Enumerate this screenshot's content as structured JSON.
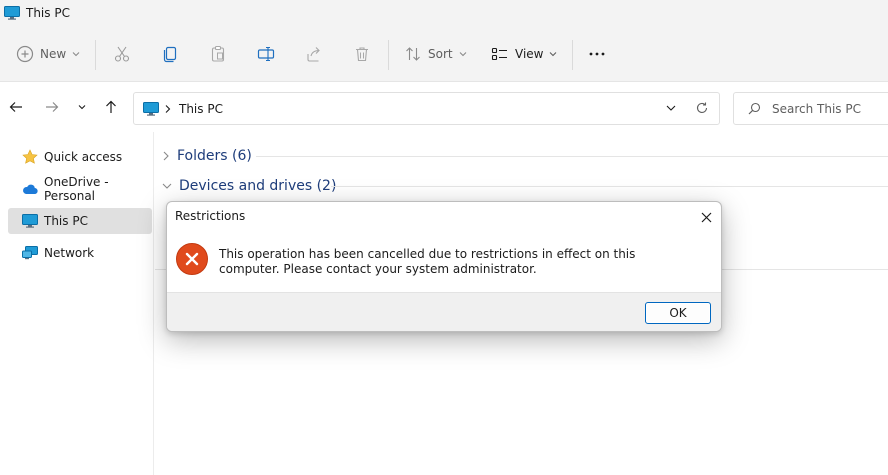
{
  "window": {
    "title": "This PC"
  },
  "toolbar": {
    "new_label": "New",
    "sort_label": "Sort",
    "view_label": "View"
  },
  "address": {
    "crumb": "This PC",
    "search_placeholder": "Search This PC"
  },
  "sidebar": {
    "items": [
      {
        "label": "Quick access"
      },
      {
        "label": "OneDrive - Personal"
      },
      {
        "label": "This PC"
      },
      {
        "label": "Network"
      }
    ]
  },
  "main": {
    "groups": [
      {
        "label": "Folders (6)"
      },
      {
        "label": "Devices and drives (2)"
      }
    ]
  },
  "dialog": {
    "title": "Restrictions",
    "message": "This operation has been cancelled due to restrictions in effect on this computer. Please contact your system administrator.",
    "ok_label": "OK"
  },
  "colors": {
    "accent": "#0067c0",
    "error": "#e04a1c",
    "group_header": "#1e3d7b"
  }
}
